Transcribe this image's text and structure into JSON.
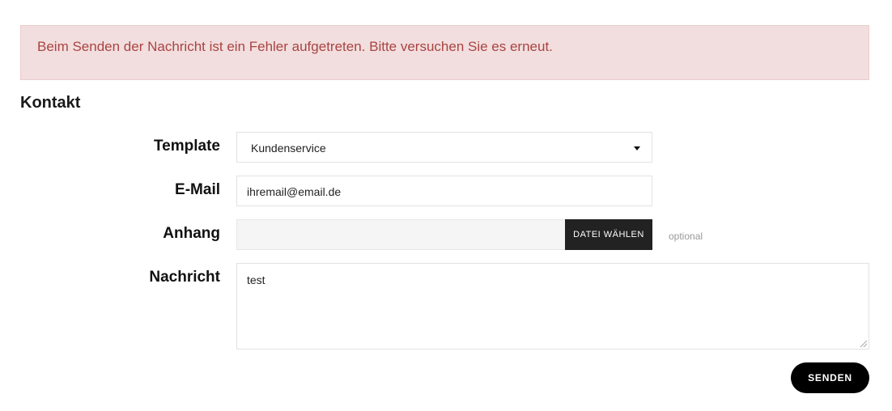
{
  "alert": {
    "message": "Beim Senden der Nachricht ist ein Fehler aufgetreten. Bitte versuchen Sie es erneut."
  },
  "page": {
    "title": "Kontakt"
  },
  "form": {
    "template": {
      "label": "Template",
      "selected": "Kundenservice"
    },
    "email": {
      "label": "E-Mail",
      "value": "ihremail@email.de"
    },
    "attachment": {
      "label": "Anhang",
      "button_label": "DATEI WÄHLEN",
      "hint": "optional"
    },
    "message": {
      "label": "Nachricht",
      "value": "test"
    },
    "submit_label": "SENDEN"
  },
  "colors": {
    "alert_bg": "#f2dede",
    "alert_text": "#a94442",
    "button_bg": "#222222",
    "submit_bg": "#000000"
  },
  "icons": {
    "select_caret": "chevron-down-icon",
    "textarea_resize": "resize-handle-icon"
  }
}
